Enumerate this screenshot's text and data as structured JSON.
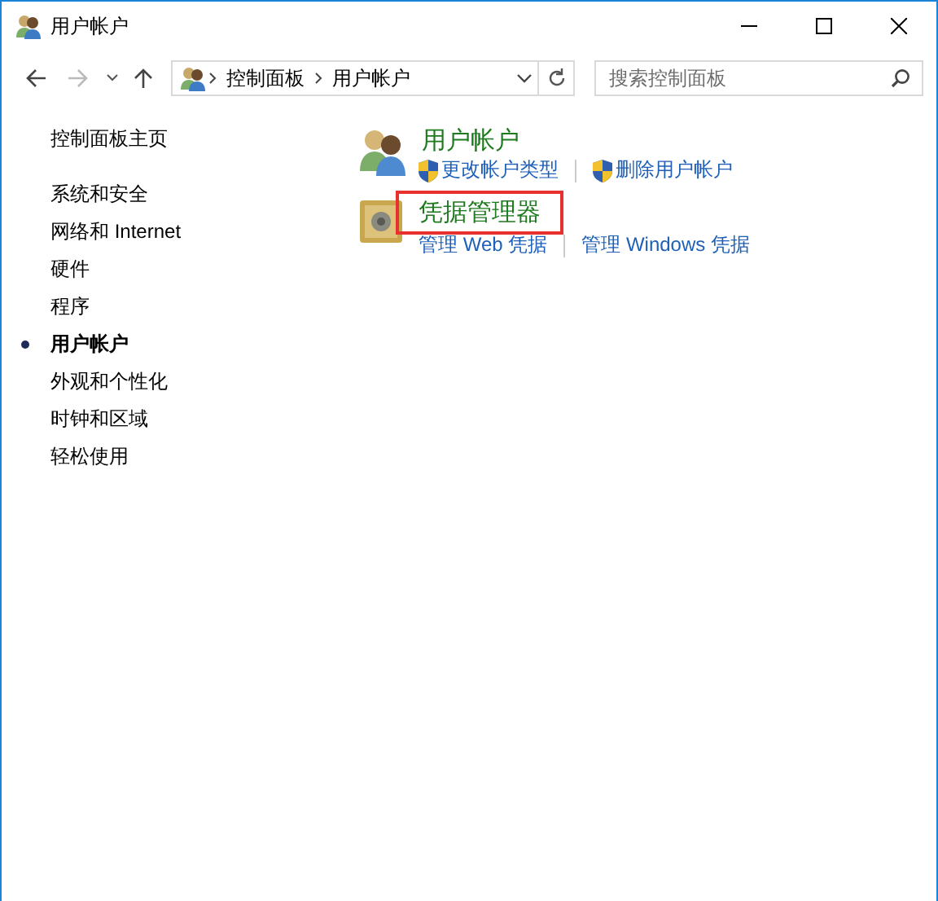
{
  "window": {
    "title": "用户帐户"
  },
  "navigation": {
    "breadcrumb": [
      "控制面板",
      "用户帐户"
    ],
    "search": {
      "placeholder": "搜索控制面板"
    }
  },
  "sidebar": {
    "home": "控制面板主页",
    "items": [
      {
        "label": "系统和安全",
        "selected": false
      },
      {
        "label": "网络和 Internet",
        "selected": false
      },
      {
        "label": "硬件",
        "selected": false
      },
      {
        "label": "程序",
        "selected": false
      },
      {
        "label": "用户帐户",
        "selected": true
      },
      {
        "label": "外观和个性化",
        "selected": false
      },
      {
        "label": "时钟和区域",
        "selected": false
      },
      {
        "label": "轻松使用",
        "selected": false
      }
    ]
  },
  "sections": [
    {
      "kind": "users",
      "title": "用户帐户",
      "highlighted": false,
      "links": [
        {
          "label": "更改帐户类型",
          "shield": true
        },
        {
          "label": "删除用户帐户",
          "shield": true
        }
      ]
    },
    {
      "kind": "vault",
      "title": "凭据管理器",
      "highlighted": true,
      "links": [
        {
          "label": "管理 Web 凭据",
          "shield": false
        },
        {
          "label": "管理 Windows 凭据",
          "shield": false
        }
      ]
    }
  ]
}
